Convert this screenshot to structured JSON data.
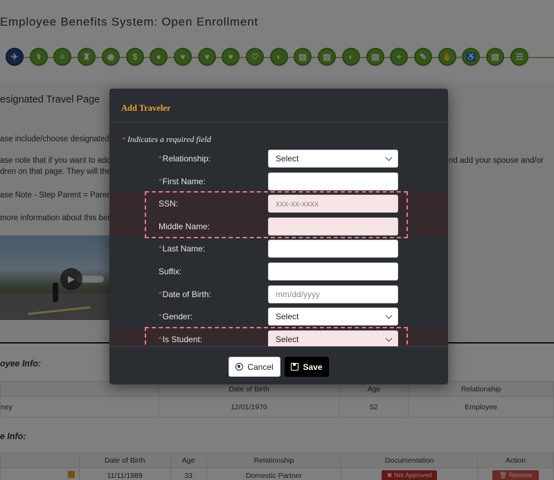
{
  "app": {
    "title": "Employee Benefits System: Open Enrollment"
  },
  "nav_icons": [
    {
      "name": "plane-icon",
      "glyph": "✈",
      "active": true
    },
    {
      "name": "medical-icon",
      "glyph": "⚕"
    },
    {
      "name": "database-icon",
      "glyph": "≡"
    },
    {
      "name": "tooth-icon",
      "glyph": "♜"
    },
    {
      "name": "eye-icon",
      "glyph": "◉"
    },
    {
      "name": "dollar-icon",
      "glyph": "$"
    },
    {
      "name": "piggy-bank-icon",
      "glyph": "●"
    },
    {
      "name": "heartbeat-icon",
      "glyph": "♥"
    },
    {
      "name": "heart-pulse-icon",
      "glyph": "♥"
    },
    {
      "name": "heart-icon",
      "glyph": "♥"
    },
    {
      "name": "heart-outline-icon",
      "glyph": "♡"
    },
    {
      "name": "pill-icon",
      "glyph": "◐"
    },
    {
      "name": "document-icon",
      "glyph": "▤"
    },
    {
      "name": "document-list-icon",
      "glyph": "▤"
    },
    {
      "name": "prescription-icon",
      "glyph": "◐"
    },
    {
      "name": "clipboard-icon",
      "glyph": "▤"
    },
    {
      "name": "user-plus-icon",
      "glyph": "+"
    },
    {
      "name": "pencil-icon",
      "glyph": "✎"
    },
    {
      "name": "handshake-icon",
      "glyph": "✋"
    },
    {
      "name": "wheelchair-icon",
      "glyph": "♿"
    },
    {
      "name": "form-icon",
      "glyph": "▤"
    },
    {
      "name": "list-icon",
      "glyph": "☰"
    }
  ],
  "page": {
    "section_title": "esignated Travel Page",
    "lines": [
      "ase include/choose designated",
      "ase note that if you want to add",
      "dren on that page.  They will the",
      "ase Note - Step Parent = Paren",
      "more information about this ben"
    ],
    "right_line": "nd add your spouse and/or"
  },
  "employee_section": {
    "heading": "oyee Info:",
    "columns": [
      "Date of Birth",
      "Age",
      "Relationship"
    ],
    "row": {
      "name": "ney",
      "dob": "12/01/1970",
      "age": "52",
      "relationship": "Employee"
    }
  },
  "spouse_section": {
    "heading": "e Info:",
    "columns": [
      "Date of Birth",
      "Age",
      "Relationship",
      "Documentation",
      "Action"
    ],
    "row": {
      "dob": "11/11/1989",
      "age": "33",
      "relationship": "Domestic Partner",
      "documentation": "✖ Not Approved",
      "action": "🗑 Remove"
    }
  },
  "modal": {
    "title": "Add Traveler",
    "required_note": "Indicates a required field",
    "fields": [
      {
        "label": "Relationship:",
        "required": true,
        "type": "select",
        "value": "Select"
      },
      {
        "label": "First Name:",
        "required": true,
        "type": "input",
        "value": "",
        "placeholder": ""
      },
      {
        "label": "SSN:",
        "required": false,
        "type": "input",
        "value": "",
        "placeholder": "xxx-xx-xxxx",
        "highlight": true
      },
      {
        "label": "Middle Name:",
        "required": false,
        "type": "input",
        "value": "",
        "placeholder": "",
        "highlight": true
      },
      {
        "label": "Last Name:",
        "required": true,
        "type": "input",
        "value": "",
        "placeholder": ""
      },
      {
        "label": "Suffix:",
        "required": false,
        "type": "input",
        "value": "",
        "placeholder": ""
      },
      {
        "label": "Date of Birth:",
        "required": true,
        "type": "input",
        "value": "",
        "placeholder": "mm/dd/yyyy"
      },
      {
        "label": "Gender:",
        "required": true,
        "type": "select",
        "value": "Select"
      },
      {
        "label": "Is Student:",
        "required": true,
        "type": "select",
        "value": "Select",
        "highlight": true
      }
    ],
    "cancel_label": "Cancel",
    "save_label": "Save"
  },
  "colors": {
    "accent": "#e8a23a",
    "nav_green": "#6aab35",
    "nav_active": "#2b4a86",
    "highlight": "#e8788a",
    "required": "#d9534f"
  }
}
